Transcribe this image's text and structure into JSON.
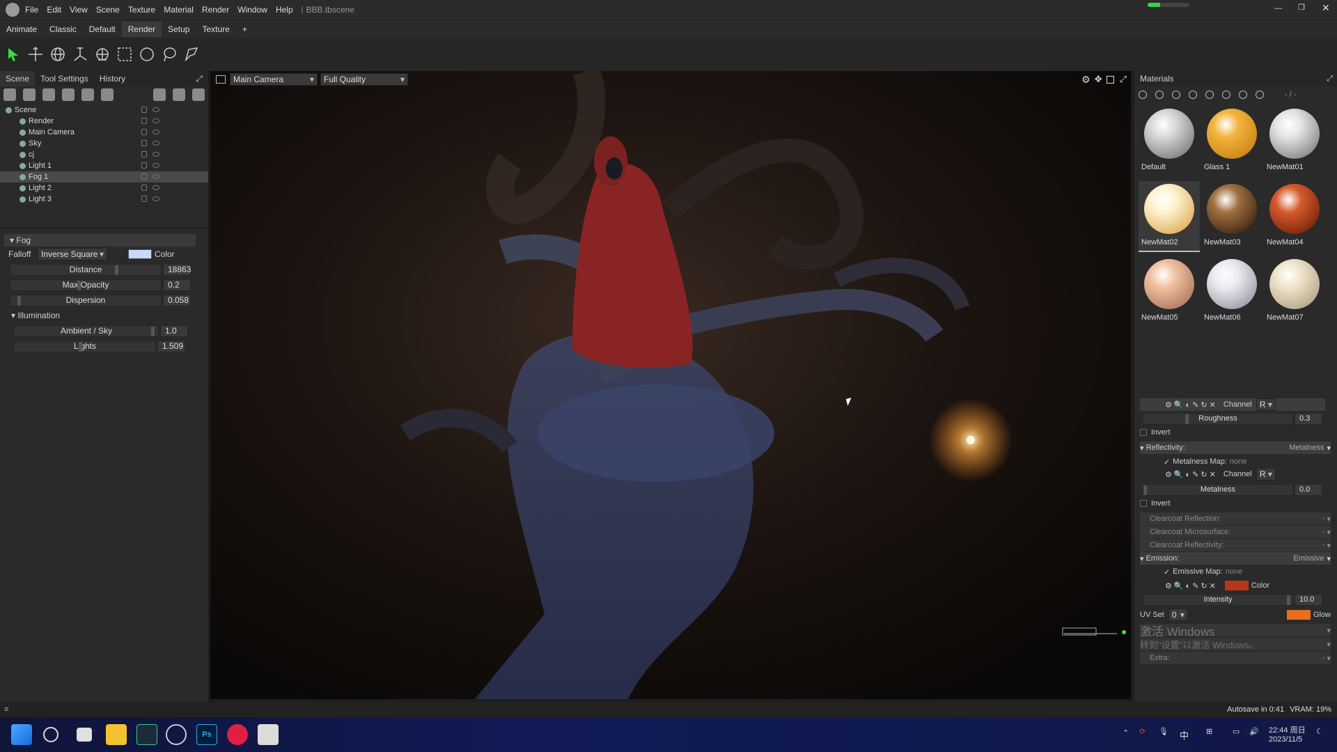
{
  "app": {
    "file": "BBB.tbscene"
  },
  "menu": [
    "File",
    "Edit",
    "View",
    "Scene",
    "Texture",
    "Material",
    "Render",
    "Window",
    "Help"
  ],
  "workspace_tabs": [
    {
      "label": "Animate"
    },
    {
      "label": "Classic"
    },
    {
      "label": "Default"
    },
    {
      "label": "Render",
      "active": true
    },
    {
      "label": "Setup"
    },
    {
      "label": "Texture"
    },
    {
      "label": "+"
    }
  ],
  "toolbar_icons": [
    "select-arrow-icon",
    "move-icon",
    "rotate-icon",
    "scale-icon",
    "transform-icon",
    "rect-select-icon",
    "circle-select-icon",
    "lasso-icon",
    "poly-lasso-icon"
  ],
  "left_tabs": [
    "Scene",
    "Tool Settings",
    "History"
  ],
  "scene_tree": [
    {
      "label": "Scene",
      "indent": 0
    },
    {
      "label": "Render",
      "indent": 1
    },
    {
      "label": "Main Camera",
      "indent": 1
    },
    {
      "label": "Sky",
      "indent": 1
    },
    {
      "label": "cj",
      "indent": 1
    },
    {
      "label": "Light 1",
      "indent": 1
    },
    {
      "label": "Fog 1",
      "indent": 1,
      "selected": true
    },
    {
      "label": "Light 2",
      "indent": 1
    },
    {
      "label": "Light 3",
      "indent": 1
    }
  ],
  "fog": {
    "section": "Fog",
    "falloff_label": "Falloff",
    "falloff_value": "Inverse Square",
    "color_label": "Color",
    "color": "#c8d8ff",
    "distance_label": "Distance",
    "distance": "18863",
    "max_opacity_label": "Max Opacity",
    "max_opacity": "0.2",
    "dispersion_label": "Dispersion",
    "dispersion": "0.058",
    "illumination_section": "Illumination",
    "ambient_label": "Ambient / Sky",
    "ambient": "1.0",
    "lights_label": "Lights",
    "lights": "1.509"
  },
  "viewport": {
    "camera": "Main Camera",
    "quality": "Full Quality"
  },
  "materials_panel": {
    "title": "Materials",
    "slash": "- / -"
  },
  "materials": [
    {
      "name": "Default",
      "color": "#d8d8d8",
      "shade": "#6a6a6a"
    },
    {
      "name": "Glass 1",
      "color": "#f2b33c",
      "shade": "#c07a10"
    },
    {
      "name": "NewMat01",
      "color": "#e4e4e4",
      "shade": "#707070"
    },
    {
      "name": "NewMat02",
      "color": "#fff2d0",
      "shade": "#d8a040",
      "selected": true
    },
    {
      "name": "NewMat03",
      "color": "#a07040",
      "shade": "#2a1608"
    },
    {
      "name": "NewMat04",
      "color": "#d65a2a",
      "shade": "#601806"
    },
    {
      "name": "NewMat05",
      "color": "#f0c0a0",
      "shade": "#a06850"
    },
    {
      "name": "NewMat06",
      "color": "#eaeaf0",
      "shade": "#8a8a96"
    },
    {
      "name": "NewMat07",
      "color": "#efe4cc",
      "shade": "#a89478"
    }
  ],
  "props": {
    "channel_label": "Channel",
    "channel_value": "R",
    "roughness_label": "Roughness",
    "roughness": "0.3",
    "invert": "Invert",
    "reflectivity": "Reflectivity:",
    "reflectivity_value": "Metalness",
    "metalness_map": "Metalness Map:",
    "none": "none",
    "metalness_label": "Metalness",
    "metalness": "0.0",
    "clearcoat_reflection": "Clearcoat Reflection:",
    "clearcoat_microsurface": "Clearcoat Microsurface:",
    "clearcoat_reflectivity": "Clearcoat Reflectivity:",
    "dash": "-",
    "emission": "Emission:",
    "emission_value": "Emissive",
    "emissive_map": "Emissive Map:",
    "emissive_color_label": "Color",
    "emissive_color": "#b8361a",
    "intensity_label": "Intensity",
    "intensity": "10.0",
    "uvset_label": "UV Set",
    "uvset_value": "0",
    "glow_label": "Glow",
    "glow_color": "#e8701c",
    "extra": "Extra:",
    "watermark1": "激活 Windows",
    "watermark2": "转到\"设置\"以激活 Windows。"
  },
  "status": {
    "autosave": "Autosave in 0:41",
    "vram": "VRAM: 19%"
  },
  "taskbar": {
    "time": "22:44 周日",
    "date": "2023/11/5",
    "ime": "中"
  }
}
